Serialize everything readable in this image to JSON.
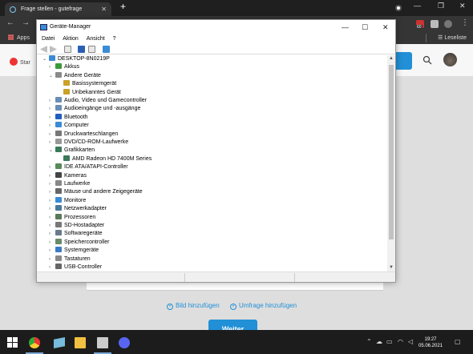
{
  "browser": {
    "tab_title": "Frage stellen - gutefrage",
    "tab_close": "✕",
    "new_tab": "+",
    "bookmarks": {
      "apps_label": "Apps",
      "reading_list": "Leseliste"
    },
    "extension_badge": "60"
  },
  "page": {
    "start_label": "Star",
    "add_image": "Bild hinzufügen",
    "add_poll": "Umfrage hinzufügen",
    "next_button": "Weiter"
  },
  "device_manager": {
    "title": "Geräte-Manager",
    "menu": [
      "Datei",
      "Aktion",
      "Ansicht",
      "?"
    ],
    "root": "DESKTOP-8N0219P",
    "tree": [
      {
        "label": "Akkus",
        "level": 1,
        "expanded": false,
        "color": "#3a9a3a"
      },
      {
        "label": "Andere Geräte",
        "level": 1,
        "expanded": true,
        "color": "#8a8a8a"
      },
      {
        "label": "Basissystemgerät",
        "level": 2,
        "expanded": null,
        "color": "#c9a227"
      },
      {
        "label": "Unbekanntes Gerät",
        "level": 2,
        "expanded": null,
        "color": "#c9a227"
      },
      {
        "label": "Audio, Video und Gamecontroller",
        "level": 1,
        "expanded": false,
        "color": "#6a8fb5"
      },
      {
        "label": "Audioeingänge und -ausgänge",
        "level": 1,
        "expanded": false,
        "color": "#6a8fb5"
      },
      {
        "label": "Bluetooth",
        "level": 1,
        "expanded": false,
        "color": "#1f5fbf"
      },
      {
        "label": "Computer",
        "level": 1,
        "expanded": false,
        "color": "#3b8bd6"
      },
      {
        "label": "Druckwarteschlangen",
        "level": 1,
        "expanded": false,
        "color": "#777777"
      },
      {
        "label": "DVD/CD-ROM-Laufwerke",
        "level": 1,
        "expanded": false,
        "color": "#999999"
      },
      {
        "label": "Grafikkarten",
        "level": 1,
        "expanded": true,
        "color": "#3a7a5a"
      },
      {
        "label": "AMD Radeon HD 7400M Series",
        "level": 2,
        "expanded": null,
        "color": "#3a7a5a"
      },
      {
        "label": "IDE ATA/ATAPI-Controller",
        "level": 1,
        "expanded": false,
        "color": "#5a8a5a"
      },
      {
        "label": "Kameras",
        "level": 1,
        "expanded": false,
        "color": "#444444"
      },
      {
        "label": "Laufwerke",
        "level": 1,
        "expanded": false,
        "color": "#888888"
      },
      {
        "label": "Mäuse und andere Zeigegeräte",
        "level": 1,
        "expanded": false,
        "color": "#666666"
      },
      {
        "label": "Monitore",
        "level": 1,
        "expanded": false,
        "color": "#3b8bd6"
      },
      {
        "label": "Netzwerkadapter",
        "level": 1,
        "expanded": false,
        "color": "#4a7a9a"
      },
      {
        "label": "Prozessoren",
        "level": 1,
        "expanded": false,
        "color": "#5a7a5a"
      },
      {
        "label": "SD-Hostadapter",
        "level": 1,
        "expanded": false,
        "color": "#777777"
      },
      {
        "label": "Softwaregeräte",
        "level": 1,
        "expanded": false,
        "color": "#6a7a8a"
      },
      {
        "label": "Speichercontroller",
        "level": 1,
        "expanded": false,
        "color": "#6a8a6a"
      },
      {
        "label": "Systemgeräte",
        "level": 1,
        "expanded": false,
        "color": "#3b7bc6"
      },
      {
        "label": "Tastaturen",
        "level": 1,
        "expanded": false,
        "color": "#888888"
      },
      {
        "label": "USB-Controller",
        "level": 1,
        "expanded": false,
        "color": "#666666"
      }
    ]
  },
  "taskbar": {
    "time": "19:27",
    "date": "05.06.2021"
  },
  "colors": {
    "accent": "#2190d6",
    "taskbar": "#1c1c1c",
    "browser_dark": "#353535"
  }
}
